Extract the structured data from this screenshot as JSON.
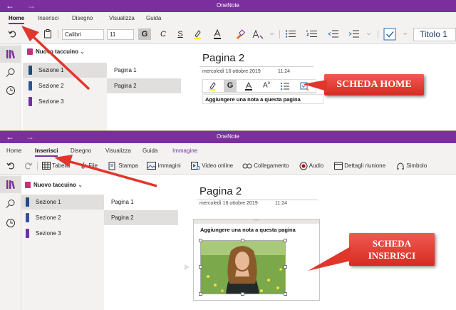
{
  "top": {
    "app_title": "OneNote",
    "tabs": [
      "Home",
      "Inserisci",
      "Disegno",
      "Visualizza",
      "Guida"
    ],
    "active_tab": "Home",
    "toolbar": {
      "font_name": "Calibri",
      "font_size": "11",
      "bold": "G",
      "italic": "C",
      "underline": "S",
      "style": "Titolo 1"
    },
    "notebook": "Nuovo taccuino",
    "sections": [
      "Sezione 1",
      "Sezione 2",
      "Sezione 3"
    ],
    "pages": [
      "Pagina 1",
      "Pagina 2"
    ],
    "page_title": "Pagina 2",
    "page_date": "mercoledì 16 ottobre 2019",
    "page_time": "11:24",
    "note_text": "Aggiungere una nota a questa pagina",
    "float_bold": "G",
    "callout": "SCHEDA HOME"
  },
  "bottom": {
    "app_title": "OneNote",
    "tabs": [
      "Home",
      "Inserisci",
      "Disegno",
      "Visualizza",
      "Guida",
      "Immagine"
    ],
    "active_tab": "Inserisci",
    "toolbar": {
      "table": "Tabella",
      "file": "File",
      "print": "Stampa",
      "images": "Immagini",
      "online_video": "Video online",
      "link": "Collegamento",
      "audio": "Audio",
      "meeting": "Dettagli riunione",
      "symbol": "Simbolo"
    },
    "notebook": "Nuovo taccuino",
    "sections": [
      "Sezione 1",
      "Sezione 2",
      "Sezione 3"
    ],
    "pages": [
      "Pagina 1",
      "Pagina 2"
    ],
    "page_title": "Pagina 2",
    "page_date": "mercoledì 16 ottobre 2019",
    "page_time": "11:24",
    "note_text": "Aggiungere una nota a questa pagina",
    "callout_line1": "SCHEDA",
    "callout_line2": "INSERISCI"
  },
  "colors": {
    "accent": "#7b2f9f",
    "callout": "#e0362c",
    "section1": "#1f4e79",
    "section2": "#2f5597",
    "section3": "#7030a0",
    "notebook": "#c0327a"
  },
  "icons": [
    "back-arrow-icon",
    "forward-arrow-icon",
    "undo-icon",
    "redo-icon",
    "clipboard-icon",
    "library-icon",
    "search-icon",
    "clock-icon",
    "checkbox-icon"
  ]
}
